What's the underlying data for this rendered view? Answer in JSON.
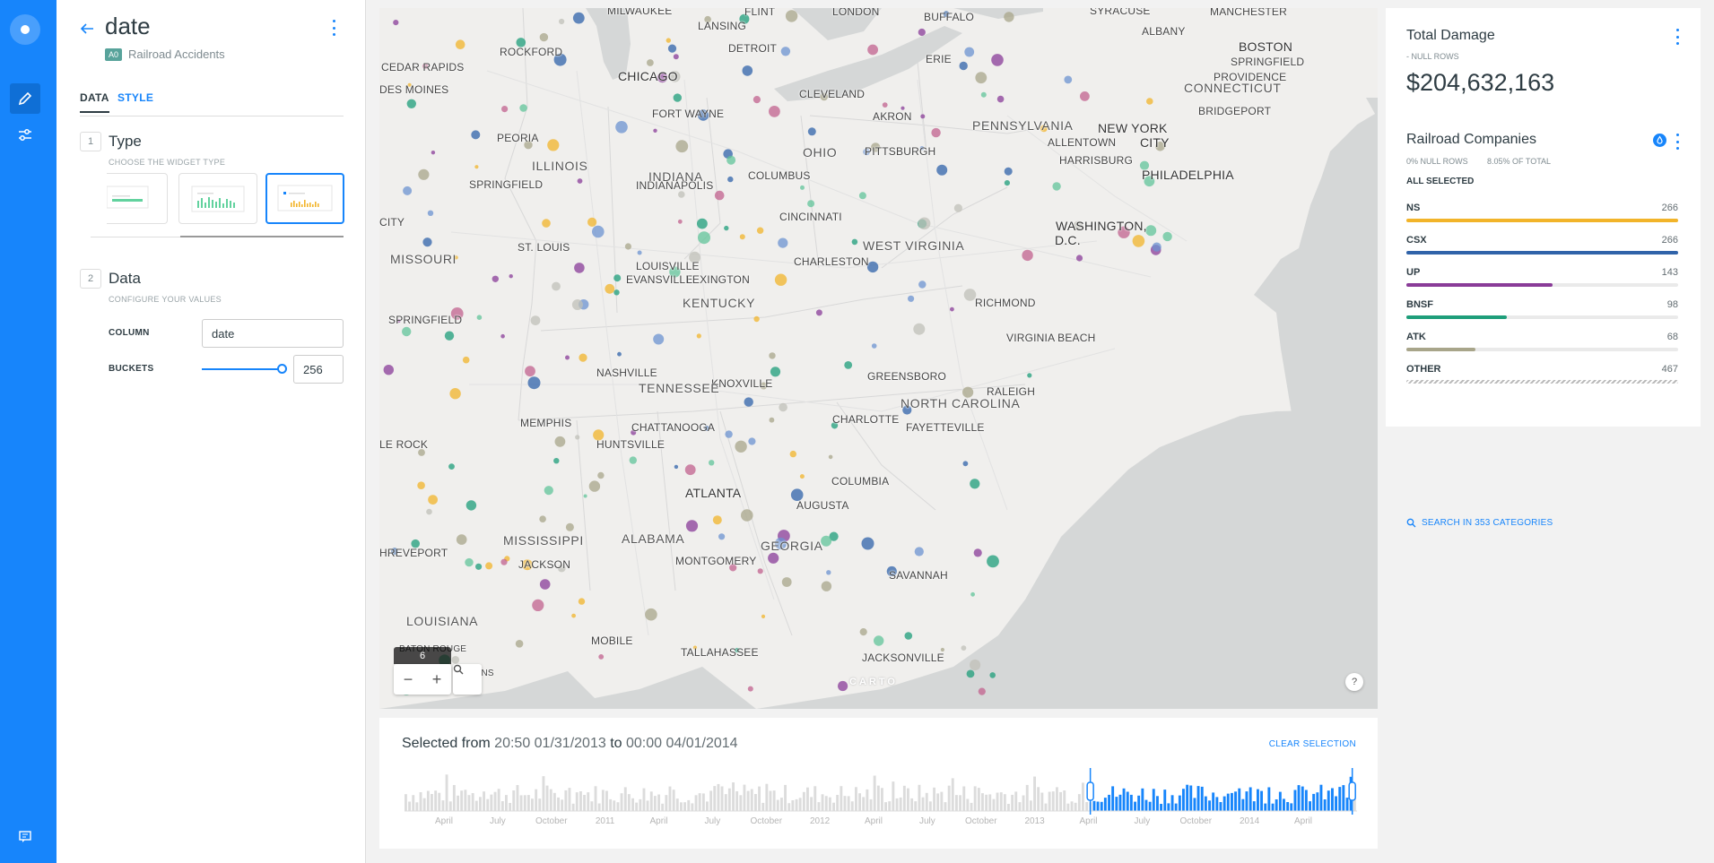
{
  "editor": {
    "title": "date",
    "source_badge": "A0",
    "source_name": "Railroad Accidents",
    "tabs": {
      "data": "DATA",
      "style": "STYLE"
    },
    "type_section": {
      "step": "1",
      "title": "Type",
      "subtitle": "CHOOSE THE WIDGET TYPE"
    },
    "data_section": {
      "step": "2",
      "title": "Data",
      "subtitle": "CONFIGURE YOUR VALUES"
    },
    "column": {
      "label": "COLUMN",
      "value": "date"
    },
    "buckets": {
      "label": "BUCKETS",
      "value": "256",
      "slider_fraction": 1.0
    }
  },
  "map": {
    "zoom_level": "6",
    "help": "?",
    "attribution": "CARTO",
    "labels": {
      "chicago": "CHICAGO",
      "milwaukee": "MILWAUKEE",
      "flint": "FLINT",
      "london": "LONDON",
      "buffalo": "BUFFALO",
      "syracuse": "SYRACUSE",
      "albany": "ALBANY",
      "manchester": "MANCHESTER",
      "lansing": "LANSING",
      "rockford": "ROCKFORD",
      "detroit": "DETROIT",
      "erie": "ERIE",
      "boston": "BOSTON",
      "springfield_ma": "SPRINGFIELD",
      "providence": "PROVIDENCE",
      "connecticut": "CONNECTICUT",
      "cedar_rapids": "CEDAR RAPIDS",
      "des_moines": "DES MOINES",
      "fort_wayne": "FORT WAYNE",
      "cleveland": "CLEVELAND",
      "akron": "AKRON",
      "pennsylvania": "PENNSYLVANIA",
      "bridgeport": "BRIDGEPORT",
      "peoria": "PEORIA",
      "new_york": "NEW YORK",
      "city": "CITY",
      "allentown": "ALLENTOWN",
      "ohio": "OHIO",
      "pittsburgh": "PITTSBURGH",
      "harrisburg": "HARRISBURG",
      "philadelphia": "PHILADELPHIA",
      "illinois": "ILLINOIS",
      "springfield_il": "SPRINGFIELD",
      "indianapolis": "INDIANAPOLIS",
      "indiana": "INDIANA",
      "columbus": "COLUMBUS",
      "cincinnati": "CINCINNATI",
      "washington": "WASHINGTON,",
      "dc": "D.C.",
      "city_w": "CITY",
      "st_louis": "ST. LOUIS",
      "west_virginia": "WEST VIRGINIA",
      "missouri": "MISSOURI",
      "louisville": "LOUISVILLE",
      "charleston": "CHARLESTON",
      "evansville": "EVANSVILLE",
      "lexington": "LEXINGTON",
      "kentucky": "KENTUCKY",
      "richmond": "RICHMOND",
      "springfield_mo": "SPRINGFIELD",
      "virginia_beach": "VIRGINIA BEACH",
      "nashville": "NASHVILLE",
      "knoxville": "KNOXVILLE",
      "greensboro": "GREENSBORO",
      "tennessee": "TENNESSEE",
      "raleigh": "RALEIGH",
      "memphis": "MEMPHIS",
      "charlotte": "CHARLOTTE",
      "north_carolina": "NORTH CAROLINA",
      "chattanooga": "CHATTANOOGA",
      "fayetteville": "FAYETTEVILLE",
      "little_rock": "LE ROCK",
      "huntsville": "HUNTSVILLE",
      "columbia": "COLUMBIA",
      "atlanta": "ATLANTA",
      "augusta": "AUGUSTA",
      "georgia": "GEORGIA",
      "mississippi": "MISSISSIPPI",
      "alabama": "ALABAMA",
      "shreveport": "HREVEPORT",
      "jackson": "JACKSON",
      "montgomery": "MONTGOMERY",
      "savannah": "SAVANNAH",
      "louisiana": "LOUISIANA",
      "mobile": "MOBILE",
      "tallahassee": "TALLAHASSEE",
      "jacksonville": "JACKSONVILLE",
      "baton_rouge": "BATON ROUGE",
      "new_orleans": "LEANS"
    }
  },
  "timeseries": {
    "prefix": "Selected from",
    "start": "20:50 01/31/2013",
    "joiner": "to",
    "end": "00:00 04/01/2014",
    "clear": "CLEAR SELECTION",
    "axis_labels": [
      "April",
      "July",
      "October",
      "2011",
      "April",
      "July",
      "October",
      "2012",
      "April",
      "July",
      "October",
      "2013",
      "April",
      "July",
      "October",
      "2014",
      "April"
    ],
    "selection_start_fraction": 0.72,
    "selection_end_fraction": 0.995,
    "accent": "#1785fb"
  },
  "widgets": {
    "damage": {
      "title": "Total Damage",
      "sub": "- NULL ROWS",
      "value": "$204,632,163"
    },
    "companies": {
      "title": "Railroad Companies",
      "null_rows": "0% NULL ROWS",
      "of_total": "8.05% OF TOTAL",
      "all_selected": "ALL SELECTED",
      "search": "SEARCH IN 353 CATEGORIES",
      "max": 266,
      "categories": [
        {
          "name": "NS",
          "count": "266",
          "value": 266,
          "color": "#f2b42a"
        },
        {
          "name": "CSX",
          "count": "266",
          "value": 266,
          "color": "#3063a9"
        },
        {
          "name": "UP",
          "count": "143",
          "value": 143,
          "color": "#8a3c98"
        },
        {
          "name": "BNSF",
          "count": "98",
          "value": 98,
          "color": "#1e9e7a"
        },
        {
          "name": "ATK",
          "count": "68",
          "value": 68,
          "color": "#a8a58a"
        },
        {
          "name": "OTHER",
          "count": "467",
          "value": 467,
          "color": "other"
        }
      ]
    }
  }
}
